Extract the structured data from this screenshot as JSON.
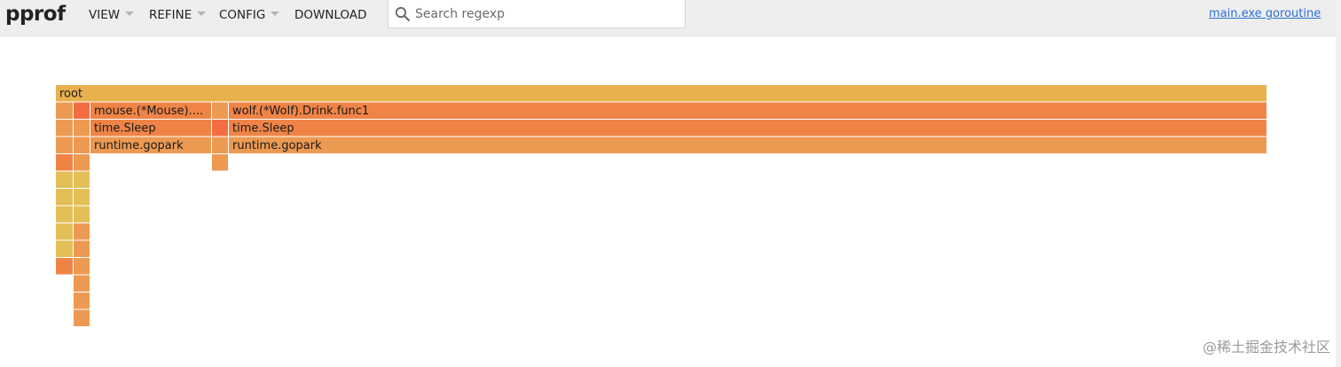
{
  "app": {
    "logo": "pprof"
  },
  "menu": [
    {
      "label": "VIEW",
      "has_caret": true
    },
    {
      "label": "REFINE",
      "has_caret": true
    },
    {
      "label": "CONFIG",
      "has_caret": true
    },
    {
      "label": "DOWNLOAD",
      "has_caret": false
    }
  ],
  "search": {
    "placeholder": "Search regexp",
    "value": ""
  },
  "header_link": "main.exe goroutine",
  "watermark": "@稀土掘金技术社区",
  "colors": {
    "root": "#e8b14d",
    "orange": "#ef8446",
    "orange_light": "#ec9a52",
    "red_orange": "#f26d43",
    "yellow": "#e2bf57",
    "link": "#2a6fd6"
  },
  "flame": {
    "frames": [
      {
        "label": "root"
      },
      {
        "label": "mouse.(*Mouse)...."
      },
      {
        "label": "wolf.(*Wolf).Drink.func1"
      },
      {
        "label": "time.Sleep"
      },
      {
        "label": "time.Sleep"
      },
      {
        "label": "runtime.gopark"
      },
      {
        "label": "runtime.gopark"
      }
    ]
  }
}
